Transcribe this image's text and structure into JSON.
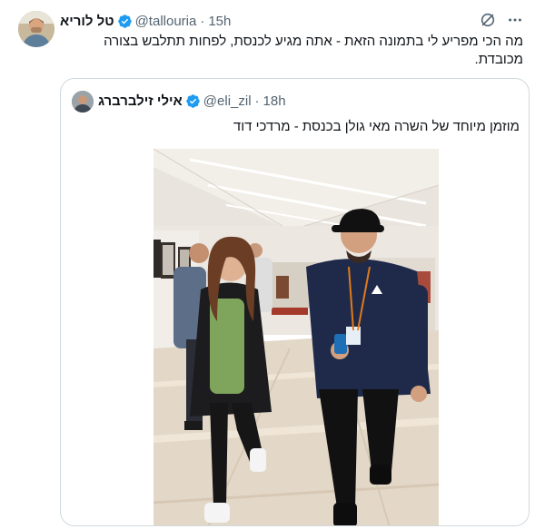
{
  "tweet": {
    "author_name": "טל לוריא",
    "handle": "@tallouria",
    "time": "15h",
    "text": "מה הכי מפריע לי בתמונה הזאת - אתה מגיע לכנסת, לפחות תתלבש בצורה מכובדת."
  },
  "quoted_tweet": {
    "author_name": "אילי זילברברג",
    "handle": "@eli_zil",
    "time": "18h",
    "text": "מוזמן מיוחד של השרה מאי גולן בכנסת - מרדכי דוד"
  },
  "icons": {
    "verified": "verified-badge-icon",
    "grok": "grok-icon",
    "more": "more-icon"
  },
  "colors": {
    "verified_blue": "#1d9bf0",
    "text": "#0f1419",
    "muted": "#536471",
    "border": "#cfd9de"
  }
}
